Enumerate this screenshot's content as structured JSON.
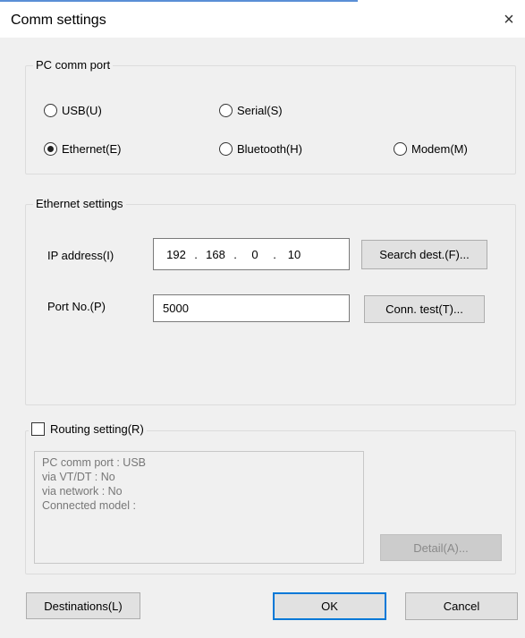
{
  "window": {
    "title": "Comm settings",
    "close_glyph": "×"
  },
  "pc_comm_port": {
    "legend": "PC comm port",
    "options": [
      {
        "label": "USB(U)",
        "checked": false
      },
      {
        "label": "Serial(S)",
        "checked": false
      },
      {
        "label": "Ethernet(E)",
        "checked": true
      },
      {
        "label": "Bluetooth(H)",
        "checked": false
      },
      {
        "label": "Modem(M)",
        "checked": false
      }
    ]
  },
  "ethernet": {
    "legend": "Ethernet settings",
    "ip_label": "IP address(I)",
    "ip": [
      "192",
      "168",
      "0",
      "10"
    ],
    "ip_dot": ".",
    "search_button": "Search dest.(F)...",
    "port_label": "Port No.(P)",
    "port_value": "5000",
    "conn_test_button": "Conn. test(T)..."
  },
  "routing": {
    "checkbox_label": "Routing setting(R)",
    "checked": false,
    "info": [
      "PC comm port : USB",
      "via VT/DT : No",
      "via network : No",
      "Connected model :"
    ],
    "detail_button": "Detail(A)..."
  },
  "footer": {
    "destinations_button": "Destinations(L)",
    "ok_button": "OK",
    "cancel_button": "Cancel"
  },
  "colors": {
    "default_button_border": "#0078d7",
    "dialog_background": "#f0f0f0"
  }
}
